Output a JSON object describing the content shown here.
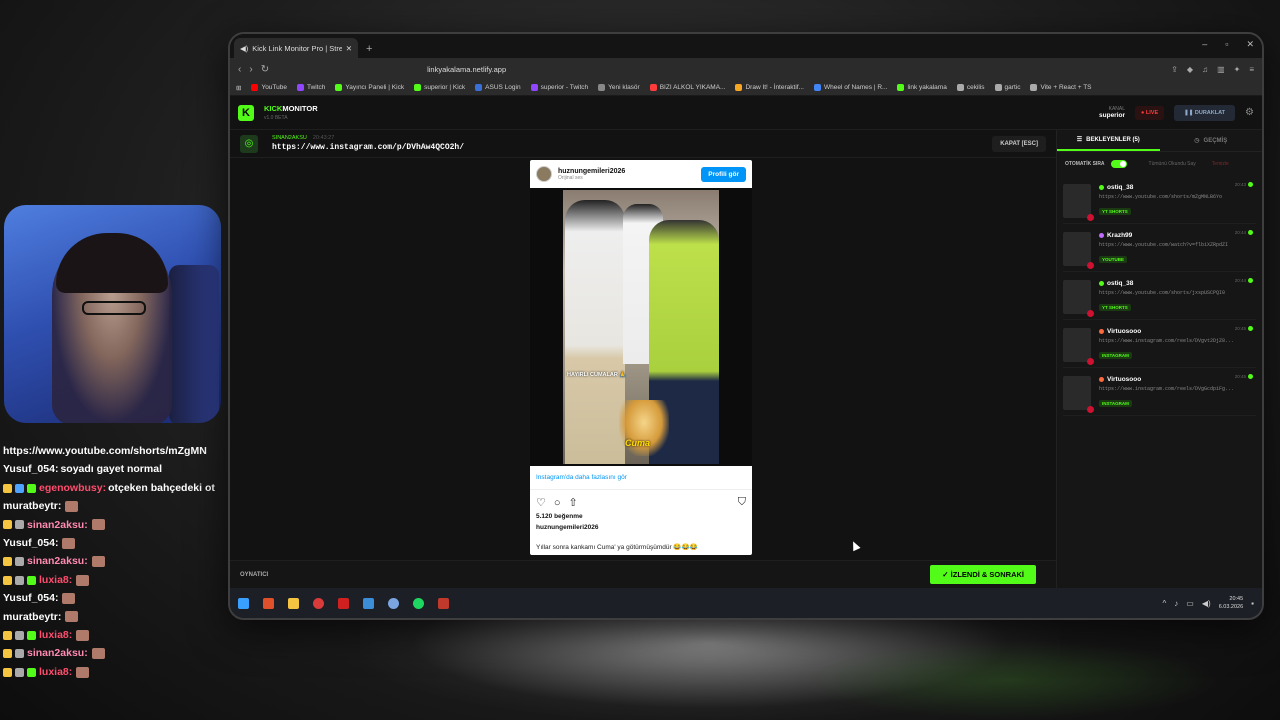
{
  "chat": [
    {
      "user": "",
      "msg": "https://www.youtube.com/shorts/mZgMN",
      "user_color": "#ffffff",
      "badges": []
    },
    {
      "user": "Yusuf_054:",
      "msg": "soyadı gayet normal",
      "user_color": "#ffffff",
      "badges": []
    },
    {
      "user": "egenowbusy:",
      "msg": "otçeken bahçedeki ot",
      "user_color": "#ff4d6d",
      "badges": [
        "#f5c542",
        "#4da3ff",
        "#53fc18"
      ]
    },
    {
      "user": "muratbeytr:",
      "msg": "",
      "user_color": "#ffffff",
      "badges": [],
      "emote": true
    },
    {
      "user": "sinan2aksu:",
      "msg": "",
      "user_color": "#ff8ab0",
      "badges": [
        "#f5c542",
        "#aaaaaa"
      ],
      "emote": true
    },
    {
      "user": "Yusuf_054:",
      "msg": "",
      "user_color": "#ffffff",
      "badges": [],
      "emote": true
    },
    {
      "user": "sinan2aksu:",
      "msg": "",
      "user_color": "#ff8ab0",
      "badges": [
        "#f5c542",
        "#aaaaaa"
      ],
      "emote": true
    },
    {
      "user": "luxia8:",
      "msg": "",
      "user_color": "#ff4d6d",
      "badges": [
        "#f5c542",
        "#aaaaaa",
        "#53fc18"
      ],
      "emote": true
    },
    {
      "user": "Yusuf_054:",
      "msg": "",
      "user_color": "#ffffff",
      "badges": [],
      "emote": true
    },
    {
      "user": "muratbeytr:",
      "msg": "",
      "user_color": "#ffffff",
      "badges": [],
      "emote": true
    },
    {
      "user": "luxia8:",
      "msg": "",
      "user_color": "#ff4d6d",
      "badges": [
        "#f5c542",
        "#aaaaaa",
        "#53fc18"
      ],
      "emote": true
    },
    {
      "user": "sinan2aksu:",
      "msg": "",
      "user_color": "#ff8ab0",
      "badges": [
        "#f5c542",
        "#aaaaaa"
      ],
      "emote": true
    },
    {
      "user": "luxia8:",
      "msg": "",
      "user_color": "#ff4d6d",
      "badges": [
        "#f5c542",
        "#aaaaaa",
        "#53fc18"
      ],
      "emote": true
    }
  ],
  "browser": {
    "tab_title": "Kick Link Monitor Pro | Stream",
    "url": "linkyakalama.netlify.app",
    "bookmarks": [
      {
        "label": "YouTube",
        "color": "#ff0000"
      },
      {
        "label": "Twitch",
        "color": "#9146ff"
      },
      {
        "label": "Yayıncı Paneli | Kick",
        "color": "#53fc18"
      },
      {
        "label": "superior | Kick",
        "color": "#53fc18"
      },
      {
        "label": "ASUS Login",
        "color": "#3a6fd8"
      },
      {
        "label": "superior - Twitch",
        "color": "#9146ff"
      },
      {
        "label": "Yeni klasör",
        "color": "#888888"
      },
      {
        "label": "BIZI ALKOL YIKAMA...",
        "color": "#ff3b3b"
      },
      {
        "label": "Draw It! - İnteraktif...",
        "color": "#f5a623"
      },
      {
        "label": "Wheel of Names | R...",
        "color": "#4285f4"
      },
      {
        "label": "link yakalama",
        "color": "#53fc18"
      },
      {
        "label": "cekilis",
        "color": "#aaaaaa"
      },
      {
        "label": "gartic",
        "color": "#aaaaaa"
      },
      {
        "label": "Vite + React + TS",
        "color": "#aaaaaa"
      }
    ]
  },
  "app": {
    "brand_kick": "KICK",
    "brand_monitor": "MONITOR",
    "version": "v1.0 BETA",
    "kanal_label": "KANAL",
    "kanal_value": "superior",
    "live_label": "LIVE",
    "pause_label": "DURAKLAT",
    "current_user": "SINAN2AKSU",
    "current_time": "20:43:27",
    "current_link": "https://www.instagram.com/p/DVhAw4QCO2h/",
    "close_label": "KAPAT [ESC]",
    "player_label": "OYNATICI",
    "next_label": "İZLENDİ & SONRAKİ",
    "tab_waiting": "BEKLEYENLER (5)",
    "tab_history": "GEÇMİŞ",
    "auto_label": "OTOMATİK SIRA",
    "mark_all": "Tümünü Okundu Say",
    "clear_label": "Temizle"
  },
  "embed": {
    "account": "huznungemileri2026",
    "audio": "Orijinal ses",
    "profile_btn": "Profili gör",
    "caption_overlay": "HAYIRLI CUMALAR 🙏",
    "sticker_text": "Cuma",
    "more_text": "Instagram'da daha fazlasını gör",
    "likes": "5.120 beğenme",
    "owner": "huznungemileri2026",
    "caption": "Yıllar sonra kankamı Cuma' ya götürmüşümdür 😂😂😂"
  },
  "queue": [
    {
      "name": "ostiq_38",
      "url": "https://www.youtube.com/shorts/mZgMNLB6Yo",
      "tag": "YT SHORTS",
      "time": "20:43",
      "dot": "#53fc18"
    },
    {
      "name": "Krazh99",
      "url": "https://www.youtube.com/watch?v=flbiXZRpdZI",
      "tag": "YOUTUBE",
      "time": "20:44",
      "dot": "#c06bff"
    },
    {
      "name": "ostiq_38",
      "url": "https://www.youtube.com/shorts/jxspUSCPQI0",
      "tag": "YT SHORTS",
      "time": "20:44",
      "dot": "#53fc18"
    },
    {
      "name": "Virtuosooo",
      "url": "https://www.instagram.com/reels/DVgvt2DjZ8...",
      "tag": "INSTAGRAM",
      "time": "20:45",
      "dot": "#ff6a3d"
    },
    {
      "name": "Virtuosooo",
      "url": "https://www.instagram.com/reels/DVgGcdpiFg...",
      "tag": "INSTAGRAM",
      "time": "20:45",
      "dot": "#ff6a3d"
    }
  ],
  "taskbar": {
    "time": "20:45",
    "date": "6.03.2026"
  },
  "colors": {
    "kick_green": "#53fc18",
    "instagram_blue": "#0095f6"
  }
}
